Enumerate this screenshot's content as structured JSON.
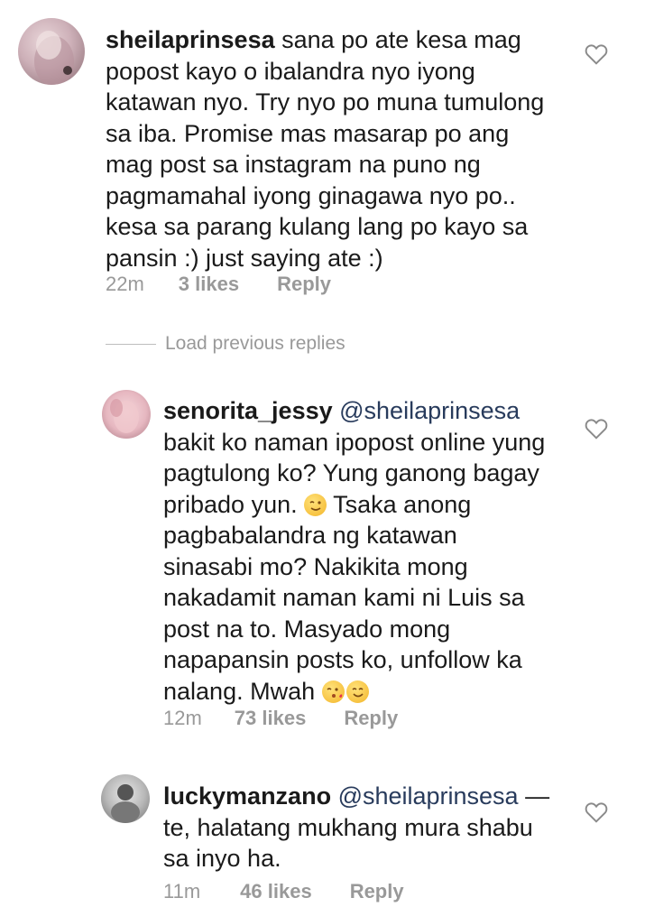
{
  "comments": [
    {
      "username": "sheilaprinsesa",
      "mention": "",
      "lines": [
        " sana po ate kesa mag",
        "popost kayo o ibalandra nyo iyong",
        "katawan nyo. Try nyo po muna tumulong",
        "sa iba. Promise mas masarap po ang",
        "mag post sa instagram na puno ng",
        "pagmamahal iyong ginagawa nyo po..",
        "kesa sa parang kulang lang po kayo sa",
        "pansin :) just saying ate :)"
      ],
      "time": "22m",
      "likes": "3 likes",
      "reply": "Reply"
    },
    {
      "username": "senorita_jessy",
      "mention": " @sheilaprinsesa",
      "lines": [
        "bakit ko naman ipopost online yung",
        "pagtulong ko? Yung ganong bagay",
        "pribado yun. ",
        " Tsaka anong",
        "pagbabalandra ng katawan",
        "sinasabi mo? Nakikita mong",
        "nakadamit naman kami ni Luis sa",
        "post na to. Masyado mong",
        "napapansin posts ko, unfollow ka",
        "nalang. Mwah "
      ],
      "time": "12m",
      "likes": "73 likes",
      "reply": "Reply"
    },
    {
      "username": "luckymanzano",
      "mention": " @sheilaprinsesa",
      "dash": " —",
      "lines": [
        "te, halatang mukhang mura shabu",
        "sa inyo ha."
      ],
      "time": "11m",
      "likes": "46 likes",
      "reply": "Reply"
    }
  ],
  "load_previous": "Load previous replies",
  "colors": {
    "text": "#1a1a1a",
    "meta": "#999999",
    "mention": "#283b5c"
  }
}
